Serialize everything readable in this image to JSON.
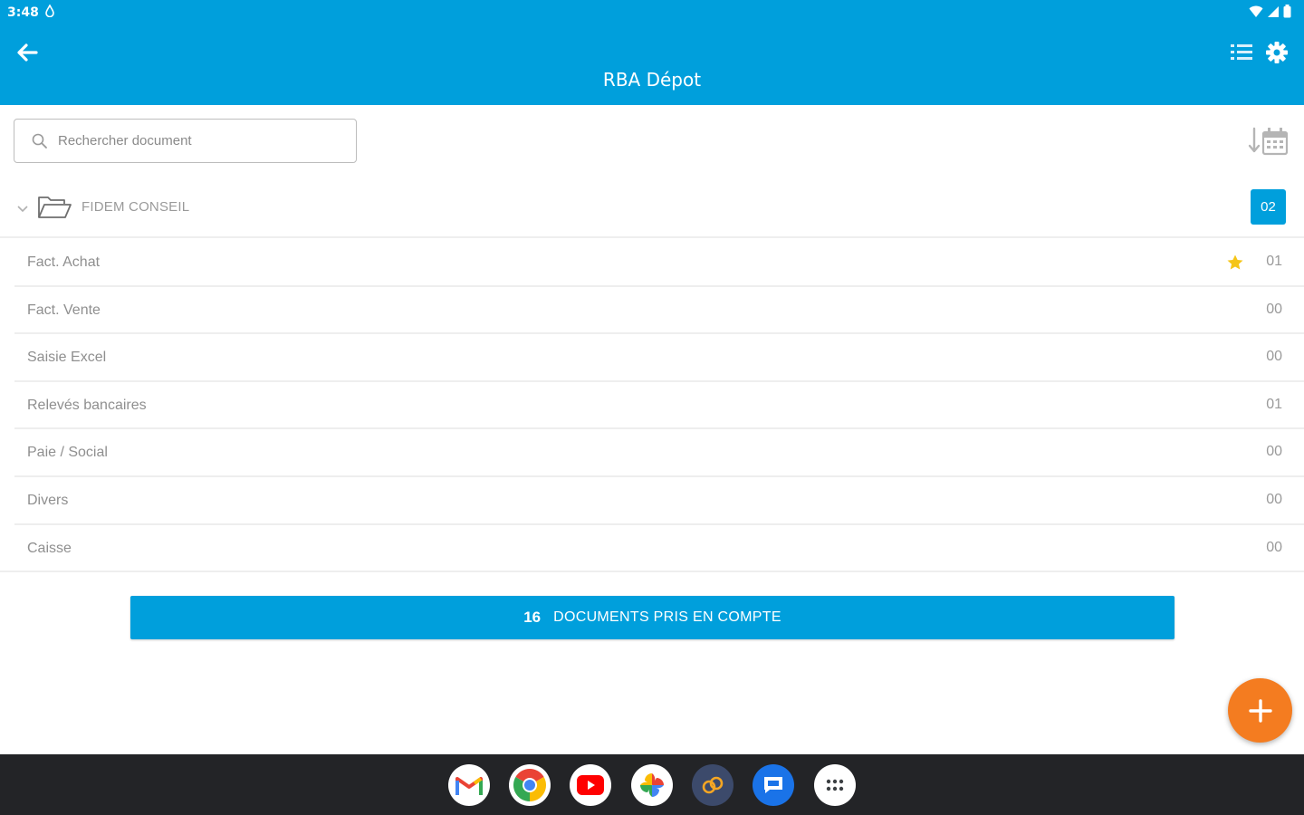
{
  "status_bar": {
    "time": "3:48"
  },
  "header": {
    "title": "RBA Dépot"
  },
  "search": {
    "placeholder": "Rechercher document"
  },
  "folder": {
    "name": "FIDEM CONSEIL",
    "count": "02"
  },
  "categories": [
    {
      "label": "Fact. Achat",
      "count": "01",
      "starred": true
    },
    {
      "label": "Fact. Vente",
      "count": "00",
      "starred": false
    },
    {
      "label": "Saisie Excel",
      "count": "00",
      "starred": false
    },
    {
      "label": "Relevés bancaires",
      "count": "01",
      "starred": false
    },
    {
      "label": "Paie / Social",
      "count": "00",
      "starred": false
    },
    {
      "label": "Divers",
      "count": "00",
      "starred": false
    },
    {
      "label": "Caisse",
      "count": "00",
      "starred": false
    }
  ],
  "documents_button": {
    "count": "16",
    "label": "DOCUMENTS PRIS EN COMPTE"
  },
  "dock_apps": [
    "gmail-icon",
    "chrome-icon",
    "youtube-icon",
    "photos-icon",
    "sync-app-icon",
    "messages-icon",
    "app-drawer-icon"
  ],
  "colors": {
    "primary": "#009fdc",
    "fab": "#f47c20",
    "star": "#f5c518",
    "dock": "#232427"
  }
}
